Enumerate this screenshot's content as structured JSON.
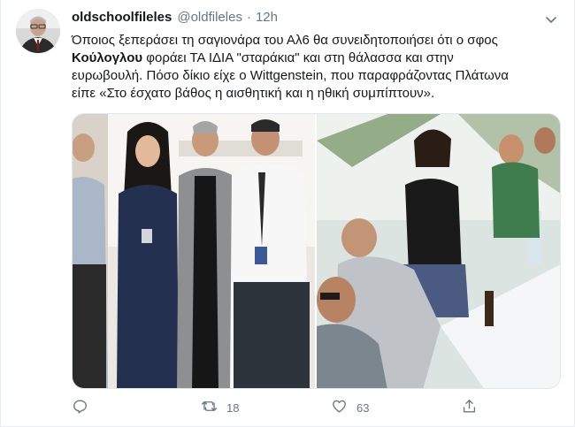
{
  "tweet": {
    "display_name": "oldschoolfileles",
    "handle": "@oldfileles",
    "separator": "·",
    "time": "12h",
    "text": {
      "line1": "Όποιος ξεπεράσει τη σαγιονάρα του Αλ6 θα συνειδητοποιήσει ότι ο σφος",
      "bold_name": "Κούλογλου",
      "line2_rest": " φοράει ΤΑ ΙΔΙΑ \"σταράκια\" και στη θάλασσα και στην",
      "line3": "ευρωβουλή. Πόσο δίκιο είχε ο Wittgenstein, που παραφράζοντας Πλάτωνα",
      "line4": "είπε «Στο έσχατο βάθος η αισθητική και η ηθική συμπίπτουν»."
    },
    "actions": {
      "reply_count": "",
      "retweet_count": "18",
      "like_count": "63"
    }
  },
  "colors": {
    "text": "#14171a",
    "secondary": "#657786",
    "border": "#e1e8ed"
  },
  "icons": [
    "avatar",
    "chevron-down-icon",
    "reply-icon",
    "retweet-icon",
    "like-icon",
    "share-icon"
  ]
}
